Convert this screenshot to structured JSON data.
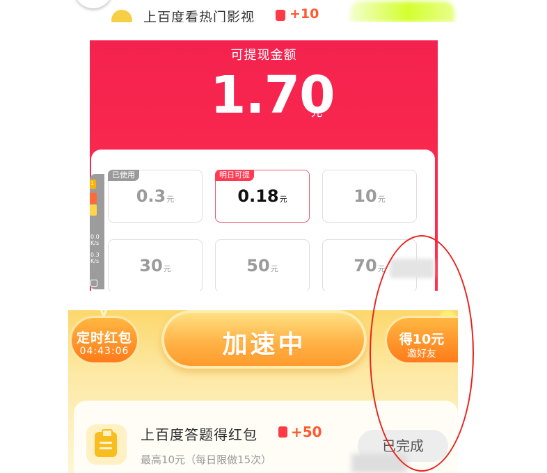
{
  "top_task": {
    "title": "上百度看热门影视",
    "points": "+10"
  },
  "withdraw": {
    "title": "可提现金额",
    "amount": "1.70",
    "unit": "元",
    "options": [
      {
        "tag": "已使用",
        "value": "0.3",
        "unit": "元",
        "state": "used"
      },
      {
        "tag": "明日可提",
        "value": "0.18",
        "unit": "元",
        "state": "selected"
      },
      {
        "tag": "",
        "value": "10",
        "unit": "元",
        "state": "normal"
      },
      {
        "tag": "",
        "value": "30",
        "unit": "元",
        "state": "normal"
      },
      {
        "tag": "",
        "value": "50",
        "unit": "元",
        "state": "normal"
      },
      {
        "tag": "",
        "value": "70",
        "unit": "元",
        "state": "normal"
      }
    ]
  },
  "side_widget": {
    "badge": "1",
    "speed_1": "0.0",
    "speed_1_unit": "K/s",
    "speed_2": "0.3",
    "speed_2_unit": "K/s"
  },
  "boost": {
    "timer_label": "定时红包",
    "timer_time": "04:43:06",
    "speed_label": "加速中",
    "invite_title": "得10元",
    "invite_sub": "邀好友"
  },
  "task": {
    "title": "上百度答题得红包",
    "points": "+50",
    "subtitle": "最高10元（每日限做15次）",
    "button_label": "已完成"
  },
  "colors": {
    "panel_red": "#f4224e",
    "accent_orange": "#ff7b1a",
    "points_orange": "#ff5a2e",
    "annotation_red": "#e8231d"
  }
}
